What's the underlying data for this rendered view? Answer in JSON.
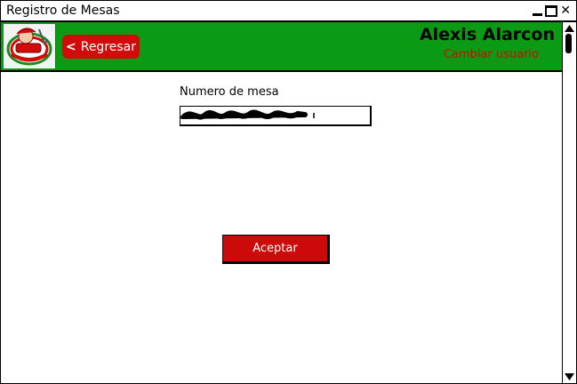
{
  "window": {
    "title": "Registro de Mesas"
  },
  "header": {
    "back_label": "Regresar",
    "user_name": "Alexis Alarcon",
    "change_user_label": "Cambiar usuario"
  },
  "form": {
    "table_label": "Numero de mesa",
    "table_value": "",
    "accept_label": "Aceptar"
  },
  "colors": {
    "header_green": "#0b9a13",
    "button_red": "#cc0a0a"
  },
  "icons": {
    "back": "chevron-left-icon",
    "logo": "restaurant-logo-icon"
  }
}
